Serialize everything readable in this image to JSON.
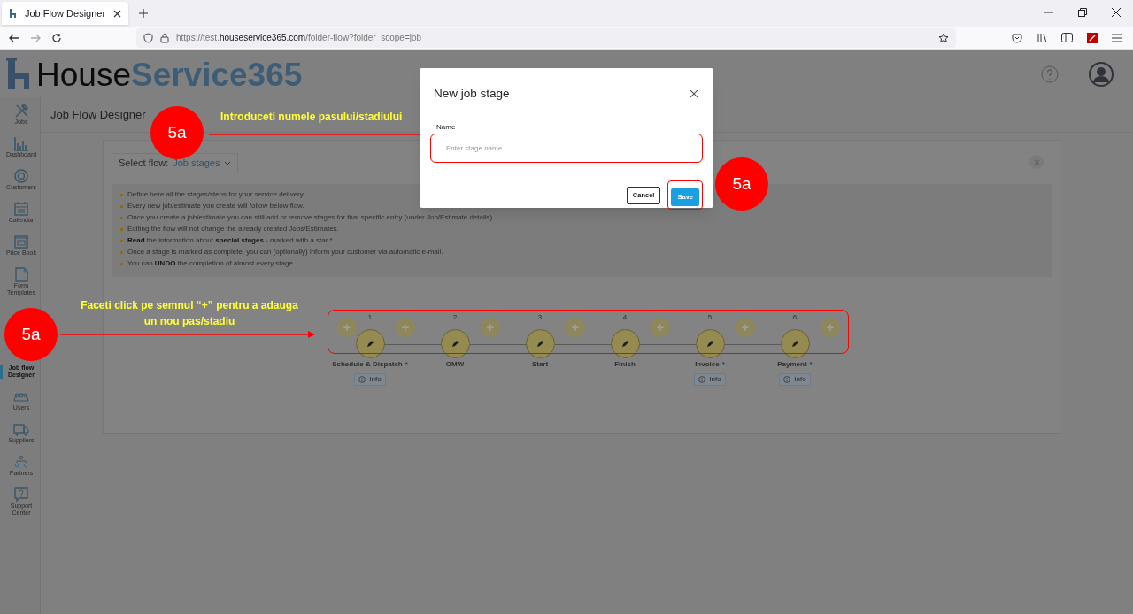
{
  "browser": {
    "tab_title": "Job Flow Designer",
    "url_prefix": "https://test.",
    "url_host": "houseservice365.com",
    "url_path": "/folder-flow?folder_scope=job"
  },
  "logo": {
    "part1": "House",
    "part2": "Service365"
  },
  "sidebar": {
    "items": [
      {
        "label": "Jobs",
        "selected": false
      },
      {
        "label": "Dashboard",
        "selected": false
      },
      {
        "label": "Customers",
        "selected": false
      },
      {
        "label": "Calendar",
        "selected": false
      },
      {
        "label": "Price Book",
        "selected": false
      },
      {
        "label": "Form Templates",
        "selected": false
      },
      {
        "label": "Job flow Designer",
        "selected": true
      },
      {
        "label": "Users",
        "selected": false
      },
      {
        "label": "Suppliers",
        "selected": false
      },
      {
        "label": "Partners",
        "selected": false
      },
      {
        "label": "Support Center",
        "selected": false
      }
    ]
  },
  "page_title": "Job Flow Designer",
  "select_flow": {
    "label": "Select flow:",
    "value": "Job stages"
  },
  "notes": [
    "Define here all the stages/steps for your service delivery.",
    "Every new job/estimate you create will follow below flow.",
    "Once you create a job/estimate you can still add or remove stages for that specific entry (under Job/Estimate details).",
    "Editing the flow will not change the already created Jobs/Estimates.",
    "**Read** the information about **special stages** - marked with a star *",
    "Once a stage is marked as complete, you can (optionally) inform your customer via automatic e-mail.",
    "You can **UNDO** the completion of almost every stage."
  ],
  "stages": [
    {
      "number": "1",
      "name": "Schedule & Dispatch",
      "star": "*",
      "info": "Info"
    },
    {
      "number": "2",
      "name": "OMW"
    },
    {
      "number": "3",
      "name": "Start"
    },
    {
      "number": "4",
      "name": "Finish"
    },
    {
      "number": "5",
      "name": "Invoice",
      "star": "*",
      "info": "Info"
    },
    {
      "number": "6",
      "name": "Payment",
      "star": "*",
      "info": "Info"
    }
  ],
  "add_buttons": [
    "+",
    "+",
    "+",
    "+",
    "+",
    "+",
    "+"
  ],
  "dialog": {
    "title": "New job stage",
    "field_label": "Name",
    "placeholder": "Enter stage name...",
    "buttons": [
      "Cancel",
      "Save"
    ]
  },
  "annotations": {
    "badges": [
      "5a",
      "5a",
      "5a"
    ],
    "caption_top": "Introduceti numele pasului/stadiului",
    "caption_left_1": "Faceti click pe semnul “+” pentru a adauga",
    "caption_left_2": "un nou pas/stadiu"
  }
}
